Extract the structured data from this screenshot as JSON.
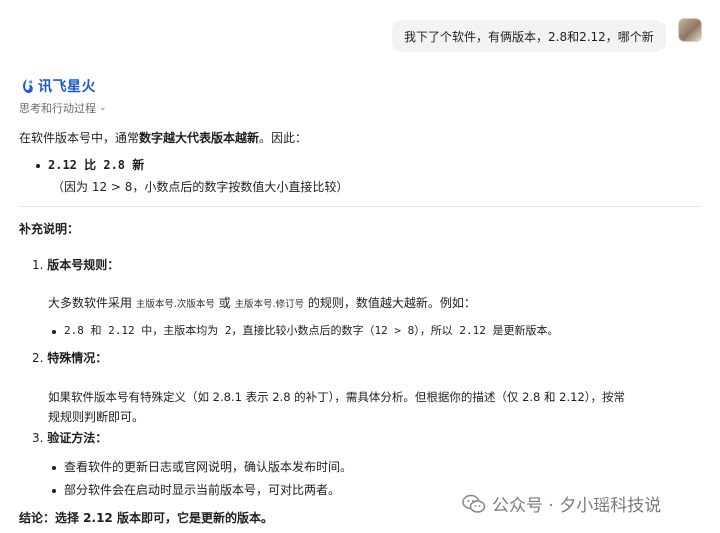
{
  "user_message": "我下了个软件，有俩版本，2.8和2.12，哪个新",
  "assistant_name": "讯飞星火",
  "thinking_toggle": "思考和行动过程",
  "intro": {
    "prefix": "在软件版本号中，通常",
    "emphasis": "数字越大代表版本越新",
    "suffix": "。因此："
  },
  "main_point": {
    "title": "2.12 比 2.8 新",
    "note": "（因为 12 > 8，小数点后的数字按数值大小直接比较）"
  },
  "supplement_title": "补充说明：",
  "sections": [
    {
      "number": "1.",
      "title": "版本号规则：",
      "text_prefix": "大多数软件采用",
      "code1": "主版本号.次版本号",
      "or": "或",
      "code2": "主版本号.修订号",
      "text_suffix": "的规则，数值越大越新。例如：",
      "bullet": "2.8 和 2.12 中，主版本均为 2，直接比较小数点后的数字（12 > 8），所以 2.12 是更新版本。"
    },
    {
      "number": "2.",
      "title": "特殊情况：",
      "line1": "如果软件版本号有特殊定义（如 2.8.1 表示 2.8 的补丁），需具体分析。但根据你的描述（仅 2.8 和 2.12），按常",
      "line2": "规规则判断即可。"
    },
    {
      "number": "3.",
      "title": "验证方法：",
      "bullets": [
        "查看软件的更新日志或官网说明，确认版本发布时间。",
        "部分软件会在启动时显示当前版本号，可对比两者。"
      ]
    }
  ],
  "conclusion": "结论：选择 2.12 版本即可，它是更新的版本。",
  "watermark": "公众号 · 夕小瑶科技说",
  "icons": {
    "logo": "spark-logo-icon",
    "chevron": "chevron-down-icon",
    "wechat": "wechat-icon"
  },
  "colors": {
    "brand": "#1b57d6",
    "bubble": "#f2f3f5"
  }
}
